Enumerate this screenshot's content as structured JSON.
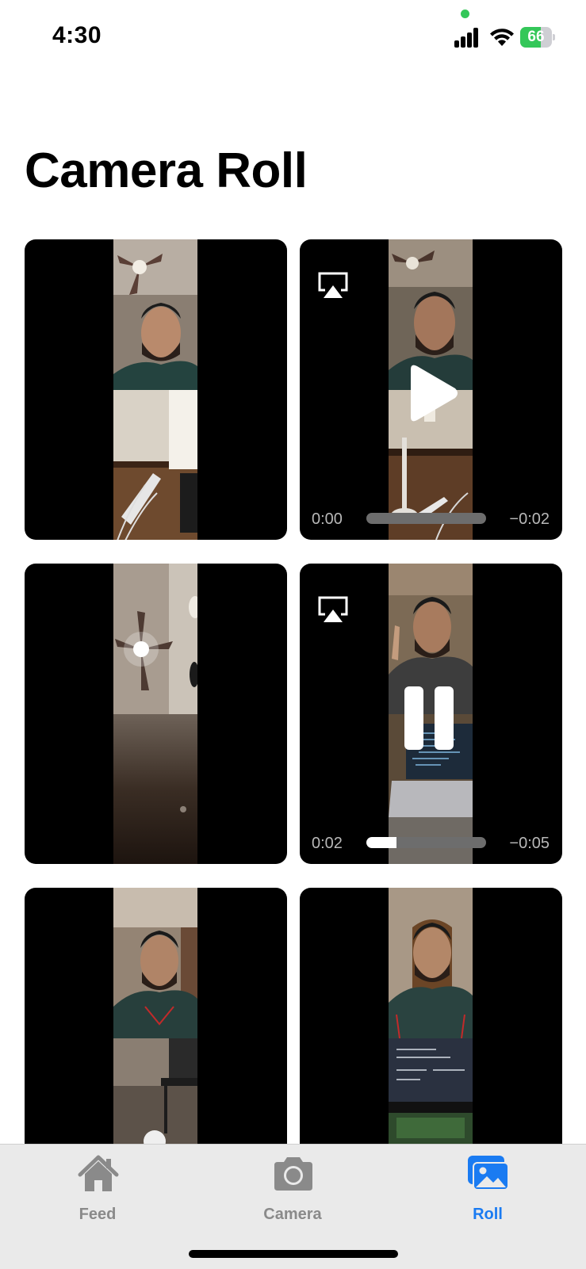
{
  "status_bar": {
    "time": "4:30",
    "battery_percent": "66",
    "battery_level": 0.66,
    "colors": {
      "privacy_dot": "#34c759",
      "battery": "#34c759"
    }
  },
  "page_title": "Camera Roll",
  "videos": [
    {
      "state": "thumbnail"
    },
    {
      "state": "paused",
      "elapsed": "0:00",
      "remaining": "−0:02",
      "progress": 0.0,
      "airplay_icon": "airplay-icon",
      "control_icon": "play-icon"
    },
    {
      "state": "thumbnail"
    },
    {
      "state": "playing",
      "elapsed": "0:02",
      "remaining": "−0:05",
      "progress": 0.25,
      "airplay_icon": "airplay-icon",
      "control_icon": "pause-icon"
    },
    {
      "state": "thumbnail"
    },
    {
      "state": "thumbnail"
    }
  ],
  "tab_bar": {
    "tabs": [
      {
        "label": "Feed",
        "icon": "house-icon",
        "active": false
      },
      {
        "label": "Camera",
        "icon": "camera-icon",
        "active": false
      },
      {
        "label": "Roll",
        "icon": "photos-icon",
        "active": true
      }
    ],
    "colors": {
      "active": "#1a7bf2",
      "inactive": "#8a8a8a"
    }
  }
}
